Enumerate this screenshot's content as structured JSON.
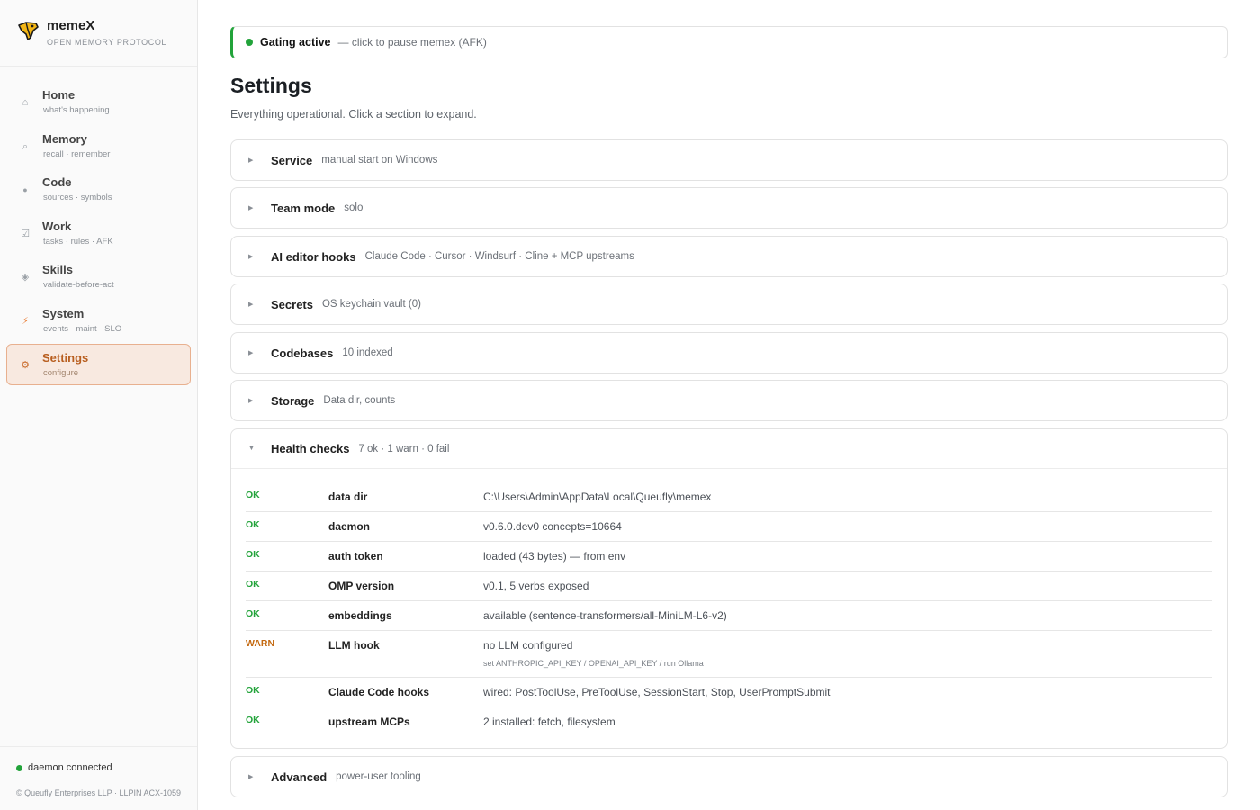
{
  "app": {
    "name": "memeX",
    "tagline": "OPEN MEMORY PROTOCOL"
  },
  "sidebar": {
    "items": [
      {
        "label": "Home",
        "sub": "what's happening",
        "icon": "home-icon"
      },
      {
        "label": "Memory",
        "sub": "recall · remember",
        "icon": "search-icon"
      },
      {
        "label": "Code",
        "sub": "sources · symbols",
        "icon": "dot-icon"
      },
      {
        "label": "Work",
        "sub": "tasks · rules · AFK",
        "icon": "checkbox-icon"
      },
      {
        "label": "Skills",
        "sub": "validate-before-act",
        "icon": "diamond-icon"
      },
      {
        "label": "System",
        "sub": "events · maint · SLO",
        "icon": "lightning-icon"
      },
      {
        "label": "Settings",
        "sub": "configure",
        "icon": "gear-icon",
        "active": true
      }
    ],
    "footer": {
      "daemon_status": "daemon connected",
      "copyright": "© Queufly Enterprises LLP · LLPIN ACX-1059"
    }
  },
  "gating": {
    "label": "Gating active",
    "hint": "— click to pause memex (AFK)"
  },
  "page": {
    "title": "Settings",
    "subtitle": "Everything operational. Click a section to expand."
  },
  "sections": [
    {
      "title": "Service",
      "summary": "manual start on Windows"
    },
    {
      "title": "Team mode",
      "summary": "solo"
    },
    {
      "title": "AI editor hooks",
      "summary": "Claude Code · Cursor · Windsurf · Cline + MCP upstreams"
    },
    {
      "title": "Secrets",
      "summary": "OS keychain vault (0)"
    },
    {
      "title": "Codebases",
      "summary": "10 indexed"
    },
    {
      "title": "Storage",
      "summary": "Data dir, counts"
    },
    {
      "title": "Health checks",
      "summary": "7 ok · 1 warn · 0 fail"
    },
    {
      "title": "Advanced",
      "summary": "power-user tooling"
    }
  ],
  "health_checks": [
    {
      "status": "OK",
      "name": "data dir",
      "value": "C:\\Users\\Admin\\AppData\\Local\\Queufly\\memex"
    },
    {
      "status": "OK",
      "name": "daemon",
      "value": "v0.6.0.dev0 concepts=10664"
    },
    {
      "status": "OK",
      "name": "auth token",
      "value": "loaded (43 bytes) — from env"
    },
    {
      "status": "OK",
      "name": "OMP version",
      "value": "v0.1, 5 verbs exposed"
    },
    {
      "status": "OK",
      "name": "embeddings",
      "value": "available (sentence-transformers/all-MiniLM-L6-v2)"
    },
    {
      "status": "WARN",
      "name": "LLM hook",
      "value": "no LLM configured",
      "hint": "set ANTHROPIC_API_KEY / OPENAI_API_KEY / run Ollama"
    },
    {
      "status": "OK",
      "name": "Claude Code hooks",
      "value": "wired: PostToolUse, PreToolUse, SessionStart, Stop, UserPromptSubmit"
    },
    {
      "status": "OK",
      "name": "upstream MCPs",
      "value": "2 installed: fetch, filesystem"
    }
  ],
  "colors": {
    "accent": "#c96a2a",
    "ok": "#22a33a",
    "warn": "#c46a12",
    "active_bg": "#f8e9e0"
  }
}
